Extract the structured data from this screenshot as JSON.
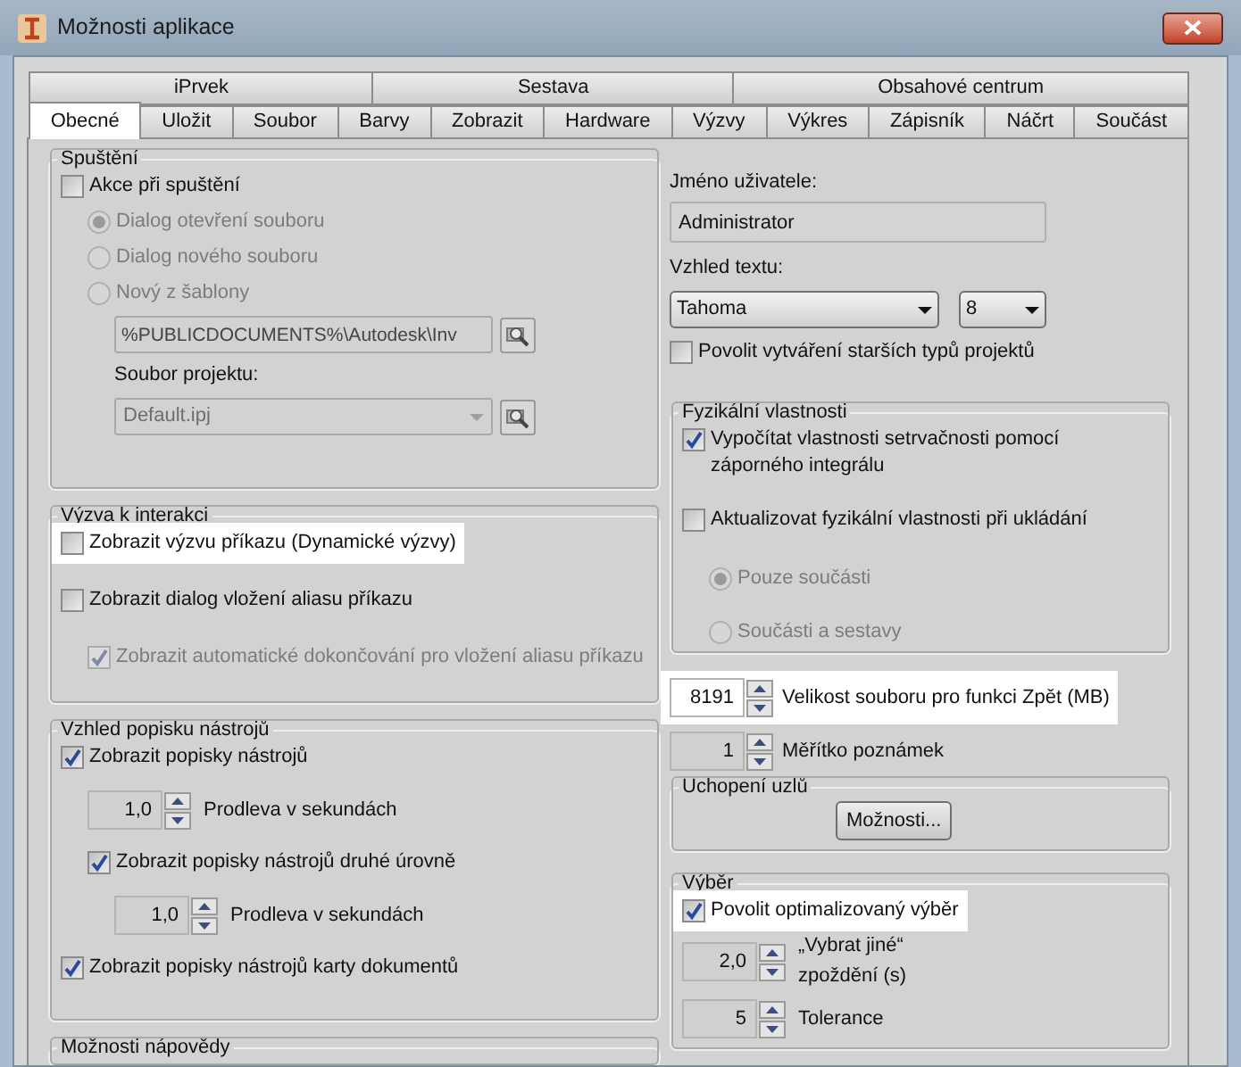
{
  "window": {
    "title": "Možnosti aplikace"
  },
  "tab_rows": [
    [
      {
        "label": "iPrvek",
        "selected": false
      },
      {
        "label": "Sestava",
        "selected": false
      },
      {
        "label": "Obsahové centrum",
        "selected": false
      }
    ],
    [
      {
        "label": "Obecné",
        "selected": true
      },
      {
        "label": "Uložit",
        "selected": false
      },
      {
        "label": "Soubor",
        "selected": false
      },
      {
        "label": "Barvy",
        "selected": false
      },
      {
        "label": "Zobrazit",
        "selected": false
      },
      {
        "label": "Hardware",
        "selected": false
      },
      {
        "label": "Výzvy",
        "selected": false
      },
      {
        "label": "Výkres",
        "selected": false
      },
      {
        "label": "Zápisník",
        "selected": false
      },
      {
        "label": "Náčrt",
        "selected": false
      },
      {
        "label": "Součást",
        "selected": false
      }
    ]
  ],
  "left_groups": [
    {
      "kind": "group",
      "title": "Spuštění",
      "items": [
        {
          "kind": "checkbox",
          "label": "Akce při spuštění",
          "checked": false,
          "disabled": false,
          "highlighted": false,
          "children": [
            {
              "kind": "radio",
              "label": "Dialog otevření souboru",
              "selected": true,
              "disabled": true
            },
            {
              "kind": "radio",
              "label": "Dialog nového souboru",
              "selected": false,
              "disabled": true
            },
            {
              "kind": "radio",
              "label": "Nový z šablony",
              "selected": false,
              "disabled": true,
              "children": [
                {
                  "kind": "path",
                  "value": "%PUBLICDOCUMENTS%\\Autodesk\\Inv",
                  "disabled": true
                },
                {
                  "kind": "label",
                  "text": "Soubor projektu:"
                },
                {
                  "kind": "select_browse",
                  "value": "Default.ipj",
                  "disabled": true
                }
              ]
            }
          ]
        }
      ]
    },
    {
      "kind": "group",
      "title": "Výzva k interakci",
      "items": [
        {
          "kind": "checkbox",
          "label": "Zobrazit výzvu příkazu (Dynamické výzvy)",
          "checked": false,
          "disabled": false,
          "highlighted": true
        },
        {
          "kind": "checkbox",
          "label": "Zobrazit dialog vložení aliasu příkazu",
          "checked": false,
          "disabled": false,
          "highlighted": false,
          "children": [
            {
              "kind": "checkbox",
              "label": "Zobrazit automatické dokončování pro vložení aliasu příkazu",
              "checked": true,
              "disabled": true,
              "highlighted": false
            }
          ]
        }
      ]
    },
    {
      "kind": "group",
      "title": "Vzhled popisku nástrojů",
      "items": [
        {
          "kind": "checkbox",
          "label": "Zobrazit popisky nástrojů",
          "checked": true,
          "disabled": false,
          "highlighted": false,
          "children": [
            {
              "kind": "spinner",
              "value": "1,0",
              "label": "Prodleva v sekundách",
              "highlighted": false
            },
            {
              "kind": "checkbox",
              "label": "Zobrazit popisky nástrojů druhé úrovně",
              "checked": true,
              "disabled": false,
              "highlighted": false,
              "children": [
                {
                  "kind": "spinner",
                  "value": "1,0",
                  "label": "Prodleva v sekundách",
                  "highlighted": false
                }
              ]
            }
          ]
        },
        {
          "kind": "checkbox",
          "label": "Zobrazit popisky nástrojů karty dokumentů",
          "checked": true,
          "disabled": false,
          "highlighted": false
        }
      ]
    },
    {
      "kind": "group",
      "title": "Možnosti nápovědy"
    }
  ],
  "right_items": [
    {
      "kind": "label",
      "text": "Jméno uživatele:"
    },
    {
      "kind": "text_field",
      "value": "Administrator"
    },
    {
      "kind": "label",
      "text": "Vzhled textu:"
    },
    {
      "kind": "select_pair",
      "selects": [
        {
          "value": "Tahoma"
        },
        {
          "value": "8"
        }
      ]
    },
    {
      "kind": "checkbox",
      "label": "Povolit vytváření starších typů projektů",
      "checked": false,
      "disabled": false,
      "highlighted": false
    },
    {
      "kind": "group",
      "title": "Fyzikální vlastnosti",
      "items": [
        {
          "kind": "checkbox",
          "label": "Vypočítat vlastnosti setrvačnosti pomocí záporného integrálu",
          "checked": true,
          "disabled": false,
          "highlighted": false
        },
        {
          "kind": "checkbox",
          "label": "Aktualizovat fyzikální vlastnosti při ukládání",
          "checked": false,
          "disabled": false,
          "highlighted": false,
          "children": [
            {
              "kind": "radio",
              "label": "Pouze součásti",
              "selected": true,
              "disabled": true
            },
            {
              "kind": "radio",
              "label": "Součásti a sestavy",
              "selected": false,
              "disabled": true
            }
          ]
        }
      ]
    },
    {
      "kind": "spinner",
      "value": "8191",
      "label": "Velikost souboru pro funkci Zpět (MB)",
      "highlighted": true
    },
    {
      "kind": "spinner",
      "value": "1",
      "label": "Měřítko poznámek",
      "highlighted": false
    },
    {
      "kind": "group",
      "title": "Uchopení uzlů",
      "items": [
        {
          "kind": "button",
          "label": "Možnosti..."
        }
      ]
    },
    {
      "kind": "group",
      "title": "Výběr",
      "items": [
        {
          "kind": "checkbox",
          "label": "Povolit optimalizovaný výběr",
          "checked": true,
          "disabled": false,
          "highlighted": true
        },
        {
          "kind": "spinner",
          "value": "2,0",
          "label": "„Vybrat jiné“ zpoždění (s)",
          "highlighted": false
        },
        {
          "kind": "spinner",
          "value": "5",
          "label": "Tolerance",
          "highlighted": false
        }
      ]
    }
  ]
}
